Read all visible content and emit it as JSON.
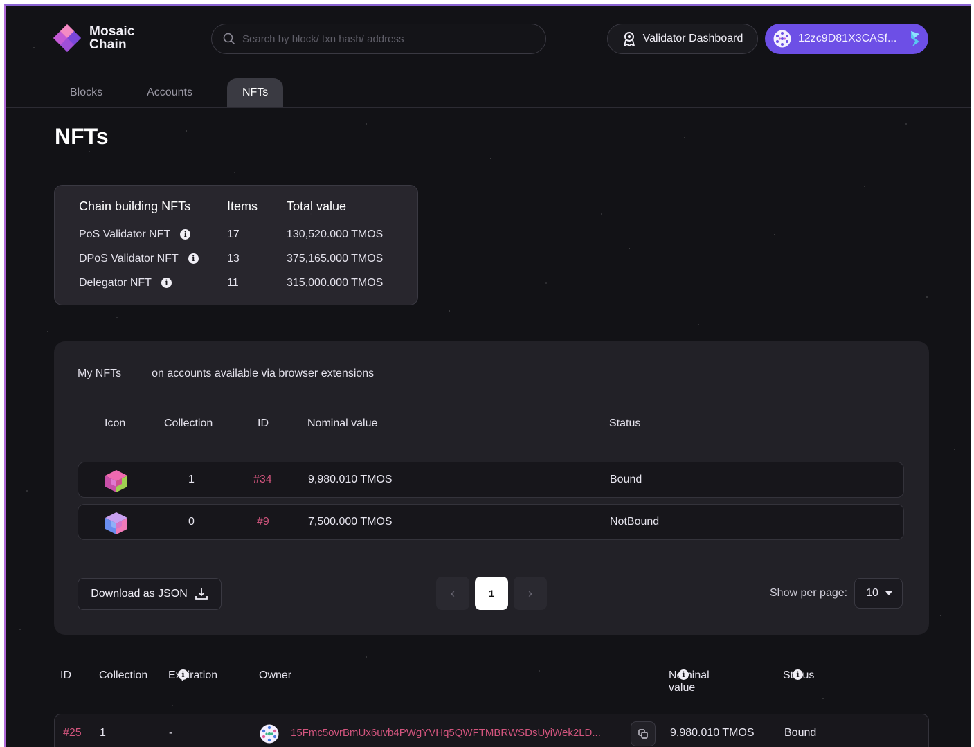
{
  "brand": {
    "name_line1": "Mosaic",
    "name_line2": "Chain"
  },
  "search": {
    "placeholder": "Search by block/ txn hash/ address"
  },
  "header": {
    "validator_label": "Validator Dashboard",
    "account_label": "12zc9D81X3CASf..."
  },
  "tabs": [
    {
      "label": "Blocks"
    },
    {
      "label": "Accounts"
    },
    {
      "label": "NFTs",
      "active": true
    }
  ],
  "page_title": "NFTs",
  "summary": {
    "headers": [
      "Chain building NFTs",
      "Items",
      "Total value"
    ],
    "rows": [
      {
        "name": "PoS Validator NFT",
        "items": "17",
        "total": "130,520.000 TMOS"
      },
      {
        "name": "DPoS Validator NFT",
        "items": "13",
        "total": "375,165.000 TMOS"
      },
      {
        "name": "Delegator NFT",
        "items": "11",
        "total": "315,000.000 TMOS"
      }
    ]
  },
  "my_nfts": {
    "title": "My NFTs",
    "subtitle": "on accounts available via browser extensions",
    "columns": [
      "Icon",
      "Collection",
      "ID",
      "Nominal value",
      "Status"
    ],
    "rows": [
      {
        "collection": "1",
        "id": "#34",
        "value": "9,980.010 TMOS",
        "status": "Bound"
      },
      {
        "collection": "0",
        "id": "#9",
        "value": "7,500.000 TMOS",
        "status": "NotBound"
      }
    ],
    "download_label": "Download as JSON",
    "pagination": {
      "prev": "‹",
      "current": "1",
      "next": "›"
    },
    "per_page_label": "Show per page:",
    "per_page_value": "10"
  },
  "all_nfts": {
    "columns": [
      "ID",
      "Collection",
      "Expiration",
      "Owner",
      "Nominal value",
      "Status"
    ],
    "rows": [
      {
        "id": "#25",
        "collection": "1",
        "expiration": "-",
        "owner": "15Fmc5ovrBmUx6uvb4PWgYVHq5QWFTMBRWSDsUyiWek2LD...",
        "value": "9,980.010 TMOS",
        "status": "Bound"
      }
    ]
  },
  "colors": {
    "accent": "#6d4fe6",
    "link": "#d3557e",
    "tab_underline": "#e04f83"
  }
}
